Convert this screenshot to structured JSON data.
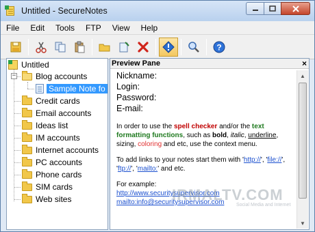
{
  "window": {
    "title": "Untitled - SecureNotes"
  },
  "menu": [
    "File",
    "Edit",
    "Tools",
    "FTP",
    "View",
    "Help"
  ],
  "toolbar": {
    "icons": [
      "save-icon",
      "cut-icon",
      "copy-icon",
      "paste-icon",
      "open-folder-icon",
      "new-note-icon",
      "delete-icon",
      "info-icon",
      "search-icon",
      "help-icon"
    ]
  },
  "tree": {
    "root": "Untitled",
    "items": [
      {
        "label": "Blog accounts",
        "open": true
      },
      {
        "label": "Sample Note fo",
        "selected": true
      },
      {
        "label": "Credit cards"
      },
      {
        "label": "Email accounts"
      },
      {
        "label": "Ideas list"
      },
      {
        "label": "IM accounts"
      },
      {
        "label": "Internet accounts"
      },
      {
        "label": "PC accounts"
      },
      {
        "label": "Phone cards"
      },
      {
        "label": "SIM cards"
      },
      {
        "label": "Web sites"
      }
    ]
  },
  "preview": {
    "title": "Preview Pane",
    "close": "×",
    "fields": [
      "Nickname:",
      "Login:",
      "Password:",
      "E-mail:"
    ],
    "para1": {
      "a": "In order to use the ",
      "spell": "spell checker",
      "b": " and/or the ",
      "format": "text formatting functions",
      "c": ", such as ",
      "bold": "bold",
      "d": ", ",
      "italic": "italic",
      "e": ", ",
      "underline": "underline",
      "f": ", sizing, ",
      "coloring": "coloring",
      "g": " and etc, use the context menu."
    },
    "para2": {
      "a": "To add links to your notes start them with '",
      "http": "http://",
      "b": "', '",
      "file": "file://",
      "c": "', '",
      "ftp": "ftp://",
      "d": "', '",
      "mailto": "mailto:",
      "e": "' and etc."
    },
    "para3": {
      "label": "For example:",
      "link1": "http://www.securitysupervisor.com",
      "link2": "mailto:info@securitysupervisor.com"
    }
  },
  "watermark": {
    "main": "IRMALTV.COM",
    "sub": "Social Media and Internet"
  }
}
